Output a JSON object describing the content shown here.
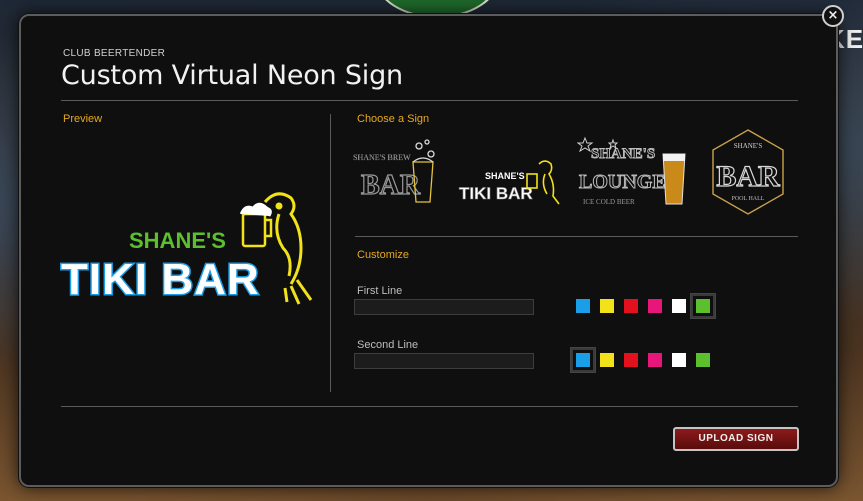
{
  "dialog": {
    "eyebrow": "CLUB BEERTENDER",
    "title": "Custom Virtual Neon Sign",
    "close_glyph": "×"
  },
  "preview": {
    "label": "Preview",
    "sign_line1": "SHANE'S",
    "sign_line2": "TIKI BAR"
  },
  "choose": {
    "label": "Choose a Sign",
    "options": [
      {
        "name": "brew-bar",
        "line1": "SHANE'S BREW",
        "line2": "BAR"
      },
      {
        "name": "tiki-bar",
        "line1": "SHANE'S",
        "line2": "TIKI BAR"
      },
      {
        "name": "lounge",
        "line1": "SHANE'S",
        "line2": "LOUNGE",
        "line3": "ICE COLD BEER"
      },
      {
        "name": "pool-hall",
        "line1": "SHANE'S",
        "line2": "BAR",
        "line3": "POOL HALL"
      }
    ]
  },
  "customize": {
    "label": "Customize",
    "first_line_label": "First Line",
    "first_line_value": "",
    "second_line_label": "Second Line",
    "second_line_value": "",
    "palette": [
      "#1a9ee8",
      "#f2e21a",
      "#e3101e",
      "#e8157a",
      "#ffffff",
      "#5bbf2e"
    ],
    "first_line_selected": 5,
    "second_line_selected": 0
  },
  "actions": {
    "upload_label": "UPLOAD SIGN"
  },
  "background": {
    "partial_sign_text": "KE"
  },
  "colors": {
    "accent_label": "#e5a81e",
    "sign_green": "#5bbf2e",
    "sign_blue": "#1a9ee8",
    "sign_yellow": "#f2e21a"
  }
}
